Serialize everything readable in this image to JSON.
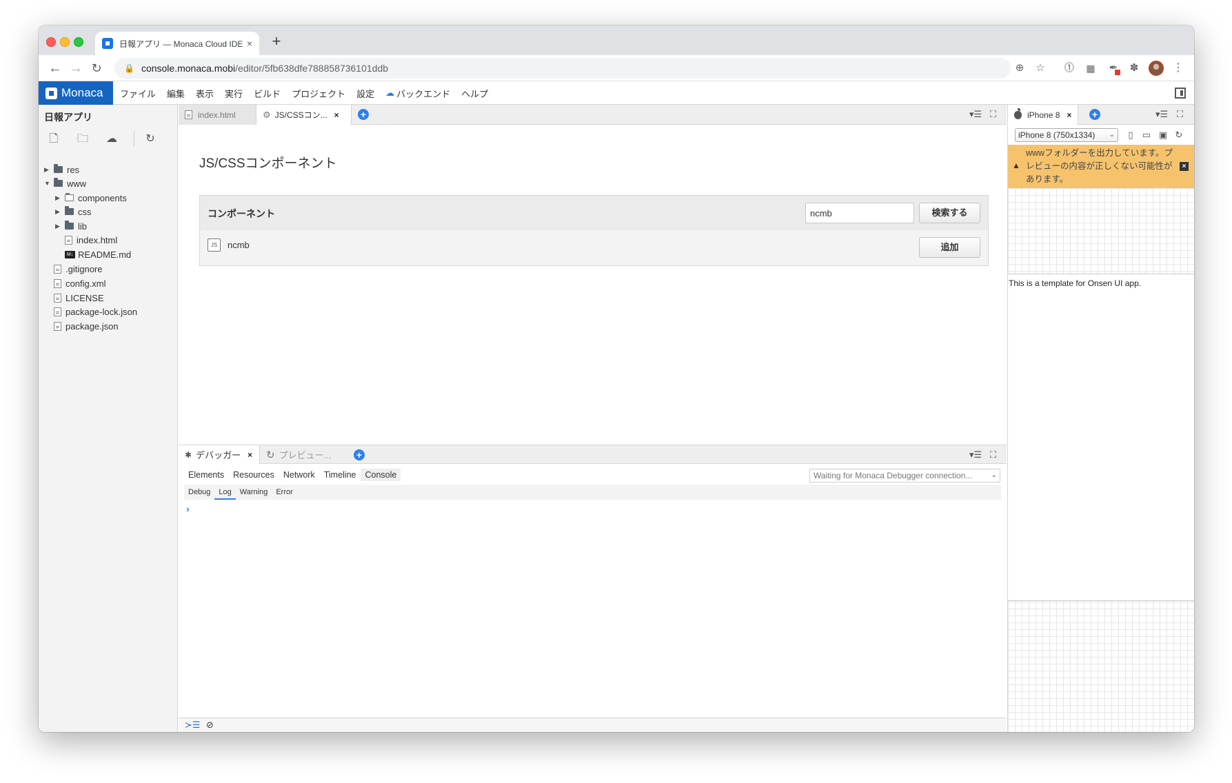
{
  "browser": {
    "tab_title": "日報アプリ — Monaca Cloud IDE",
    "tab_close": "×",
    "new_tab": "+",
    "url_host": "console.monaca.mobi",
    "url_path": "/editor/5fb638dfe788858736101ddb"
  },
  "menubar": {
    "logo_text": "Monaca",
    "items": [
      "ファイル",
      "編集",
      "表示",
      "実行",
      "ビルド",
      "プロジェクト",
      "設定",
      "バックエンド",
      "ヘルプ"
    ]
  },
  "sidebar": {
    "project_name": "日報アプリ",
    "tree": [
      {
        "label": "res",
        "type": "folder",
        "expanded": false
      },
      {
        "label": "www",
        "type": "folder",
        "expanded": true
      },
      {
        "label": "components",
        "type": "folder-outline",
        "expanded": false
      },
      {
        "label": "css",
        "type": "folder",
        "expanded": false
      },
      {
        "label": "lib",
        "type": "folder",
        "expanded": false
      },
      {
        "label": "index.html",
        "type": "file"
      },
      {
        "label": "README.md",
        "type": "markdown",
        "icon_text": "M↓"
      },
      {
        "label": ".gitignore",
        "type": "file"
      },
      {
        "label": "config.xml",
        "type": "file"
      },
      {
        "label": "LICENSE",
        "type": "file"
      },
      {
        "label": "package-lock.json",
        "type": "file"
      },
      {
        "label": "package.json",
        "type": "file"
      }
    ]
  },
  "editor": {
    "tabs": [
      {
        "label": "index.html",
        "active": false
      },
      {
        "label": "JS/CSSコン...",
        "active": true,
        "close": "×"
      }
    ],
    "title": "JS/CSSコンポーネント",
    "component_label": "コンポーネント",
    "search_value": "ncmb",
    "search_button": "検索する",
    "result": {
      "icon_text": "JS",
      "name": "ncmb",
      "add_button": "追加"
    }
  },
  "debugger": {
    "tabs": [
      {
        "label": "デバッガー",
        "active": true,
        "close": "×"
      },
      {
        "label": "プレビュー...",
        "active": false
      }
    ],
    "devtools_tabs": [
      "Elements",
      "Resources",
      "Network",
      "Timeline",
      "Console"
    ],
    "selected_devtools_tab": "Console",
    "connection_status": "Waiting for Monaca Debugger connection...",
    "levels": [
      "Debug",
      "Log",
      "Warning",
      "Error"
    ],
    "active_level": "Log",
    "prompt": "›"
  },
  "preview": {
    "tab_label": "iPhone 8",
    "tab_close": "×",
    "device_option": "iPhone 8 (750x1334)",
    "warning_text": "wwwフォルダーを出力しています。プレビューの内容が正しくない可能性があります。",
    "warning_close": "×",
    "screen_text": "This is a template for Onsen UI app."
  },
  "colors": {
    "brand": "#1565c0",
    "accent": "#2f80ed",
    "warning_bg": "#f6c36c"
  },
  "icons": {
    "back": "arrow-left-icon",
    "forward": "arrow-right-icon",
    "reload": "reload-icon",
    "new_file": "new-file-icon",
    "new_folder": "new-folder-icon",
    "upload": "cloud-upload-icon",
    "sync": "sync-icon"
  }
}
